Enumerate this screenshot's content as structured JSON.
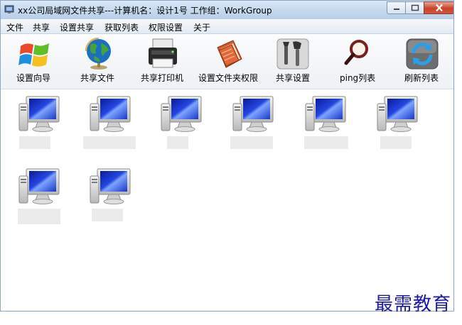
{
  "window": {
    "title": "xx公司局域网文件共享---计算机名：设计1号  工作组：WorkGroup",
    "accent": "#1a1aa6"
  },
  "menu": [
    "文件",
    "共享",
    "设置共享",
    "获取列表",
    "权限设置",
    "关于"
  ],
  "toolbar": [
    {
      "label": "设置向导",
      "icon": "windows-logo-icon"
    },
    {
      "label": "共享文件",
      "icon": "globe-icon"
    },
    {
      "label": "共享打印机",
      "icon": "printer-icon"
    },
    {
      "label": "设置文件夹权限",
      "icon": "folder-book-icon"
    },
    {
      "label": "共享设置",
      "icon": "tools-icon"
    },
    {
      "label": "ping列表",
      "icon": "magnifier-icon"
    },
    {
      "label": "刷新列表",
      "icon": "refresh-icon"
    }
  ],
  "computers": [
    {
      "icon": "computer-icon"
    },
    {
      "icon": "computer-icon"
    },
    {
      "icon": "computer-icon"
    },
    {
      "icon": "computer-icon"
    },
    {
      "icon": "computer-icon"
    },
    {
      "icon": "computer-icon"
    },
    {
      "icon": "computer-icon"
    },
    {
      "icon": "computer-icon"
    }
  ],
  "watermark": "最需教育"
}
